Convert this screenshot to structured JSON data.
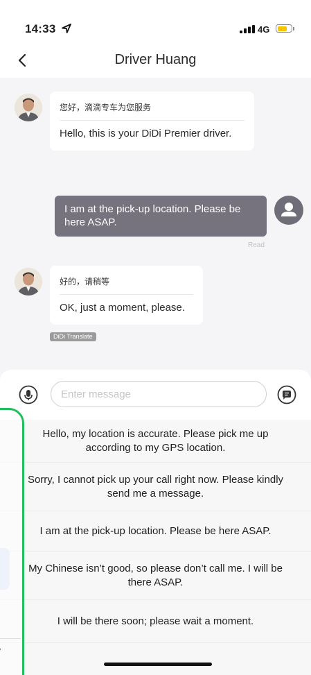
{
  "status_bar": {
    "time": "14:33",
    "network": "4G"
  },
  "nav": {
    "title": "Driver Huang"
  },
  "messages": [
    {
      "zh": "您好，滴滴专车为您服务",
      "en": "Hello, this is your DiDi Premier driver."
    },
    {
      "text": "I am at the pick-up location. Please be here ASAP.",
      "status": "Read"
    },
    {
      "zh": "好的，请稍等",
      "en": "OK, just a moment, please.",
      "tag": "DiDi Translate"
    }
  ],
  "input": {
    "placeholder": "Enter message"
  },
  "quick_phrases": [
    "Hello, my location is accurate. Please pick me up according to my GPS location.",
    "Sorry, I cannot pick up your call right now. Please kindly send me a message.",
    "I am at the pick-up location. Please be here ASAP.",
    "My Chinese isn’t good, so please don’t call me. I will be there ASAP.",
    "I will be there soon; please wait a moment."
  ],
  "colors": {
    "accent": "#f7c600",
    "outgoing_bubble": "#76737f",
    "overlay_border": "#1fbf5b"
  }
}
